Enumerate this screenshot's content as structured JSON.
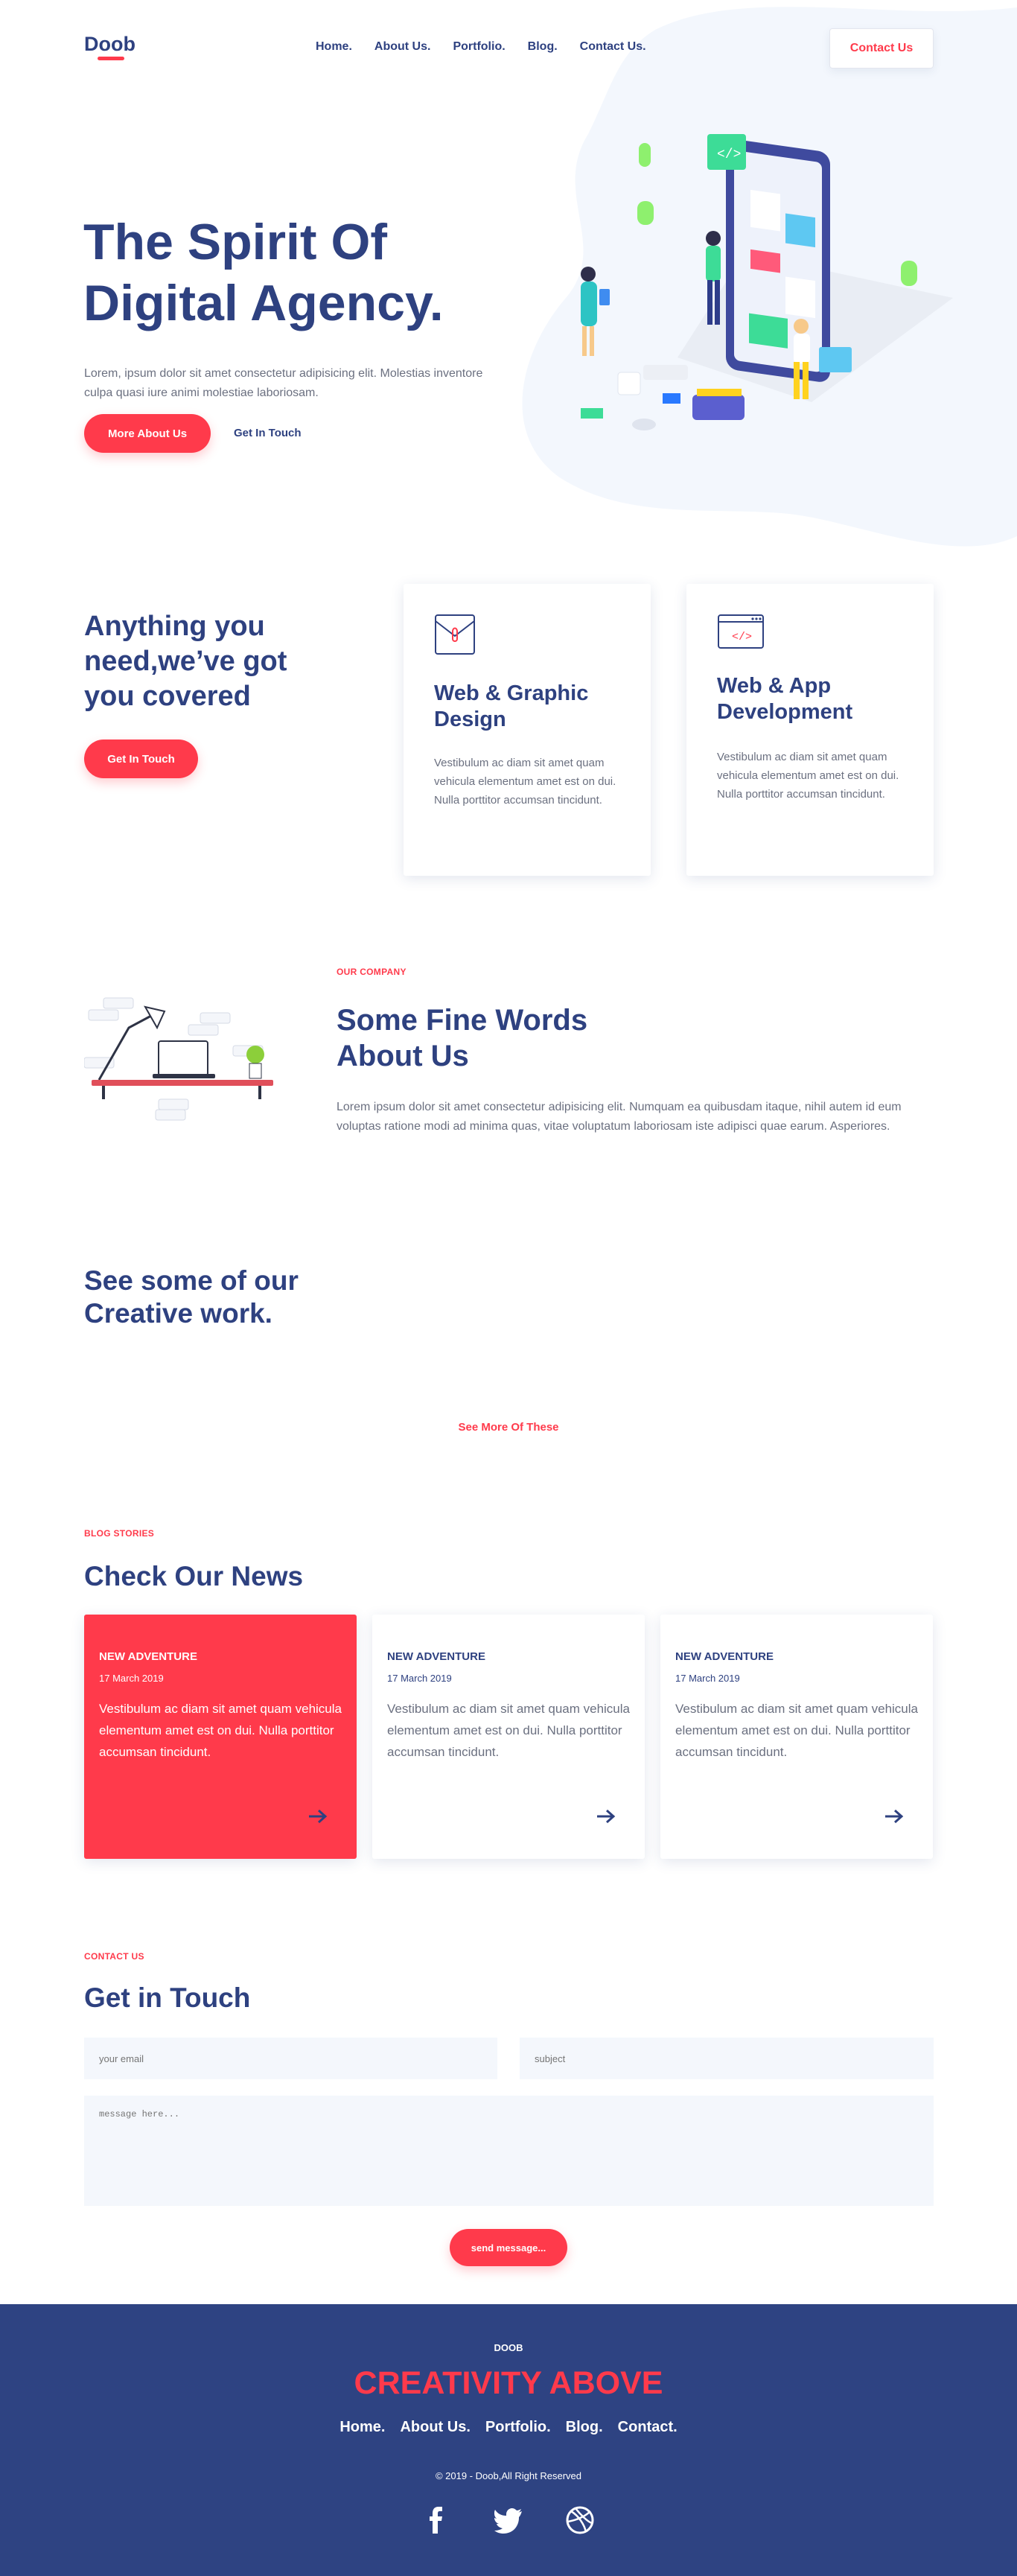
{
  "colors": {
    "primary": "#2e4180",
    "accent": "#ff3a4b",
    "footer_bg": "#2e4382",
    "text_muted": "#6b7080"
  },
  "header": {
    "logo": "Doob",
    "nav": [
      "Home.",
      "About Us.",
      "Portfolio.",
      "Blog.",
      "Contact Us."
    ],
    "cta": "Contact Us"
  },
  "hero": {
    "title": "The Spirit Of Digital Agency.",
    "text": "Lorem, ipsum dolor sit amet consectetur adipisicing elit. Molestias inventore culpa quasi iure animi molestiae laboriosam.",
    "primary_button": "More About Us",
    "secondary_link": "Get In Touch"
  },
  "services": {
    "title": "Anything you need,we’ve got you covered",
    "button": "Get In Touch",
    "items": [
      {
        "icon": "envelope-icon",
        "title": "Web & Graphic Design",
        "text": "Vestibulum ac diam sit amet quam vehicula elementum amet est on dui. Nulla porttitor accumsan tincidunt."
      },
      {
        "icon": "code-window-icon",
        "title": "Web & App Development",
        "text": "Vestibulum ac diam sit amet quam vehicula elementum amet est on dui. Nulla porttitor accumsan tincidunt."
      }
    ]
  },
  "about": {
    "eyebrow": "OUR COMPANY",
    "title": "Some Fine Words About Us",
    "text": "Lorem ipsum dolor sit amet consectetur adipisicing elit. Numquam ea quibusdam itaque, nihil autem id eum voluptas ratione modi ad minima quas, vitae voluptatum laboriosam iste adipisci quae earum. Asperiores."
  },
  "work": {
    "title": "See some of our Creative work.",
    "see_more": "See More Of These"
  },
  "news": {
    "eyebrow": "BLOG STORIES",
    "title": "Check Our News",
    "items": [
      {
        "tag": "NEW ADVENTURE",
        "date": "17 March 2019",
        "text": "Vestibulum ac diam sit amet quam vehicula elementum amet est on dui. Nulla porttitor accumsan tincidunt."
      },
      {
        "tag": "NEW ADVENTURE",
        "date": "17 March 2019",
        "text": "Vestibulum ac diam sit amet quam vehicula elementum amet est on dui. Nulla porttitor accumsan tincidunt."
      },
      {
        "tag": "NEW ADVENTURE",
        "date": "17 March 2019",
        "text": "Vestibulum ac diam sit amet quam vehicula elementum amet est on dui. Nulla porttitor accumsan tincidunt."
      }
    ]
  },
  "contact": {
    "eyebrow": "CONTACT US",
    "title": "Get in Touch",
    "email_placeholder": "your email",
    "subject_placeholder": "subject",
    "message_placeholder": "message here...",
    "send": "send message..."
  },
  "footer": {
    "brand": "DOOB",
    "slogan": "CREATIVITY ABOVE",
    "nav": [
      "Home.",
      "About Us.",
      "Portfolio.",
      "Blog.",
      "Contact."
    ],
    "copyright": "© 2019 - Doob,All Right Reserved",
    "social": [
      "facebook-icon",
      "twitter-icon",
      "dribbble-icon"
    ]
  }
}
